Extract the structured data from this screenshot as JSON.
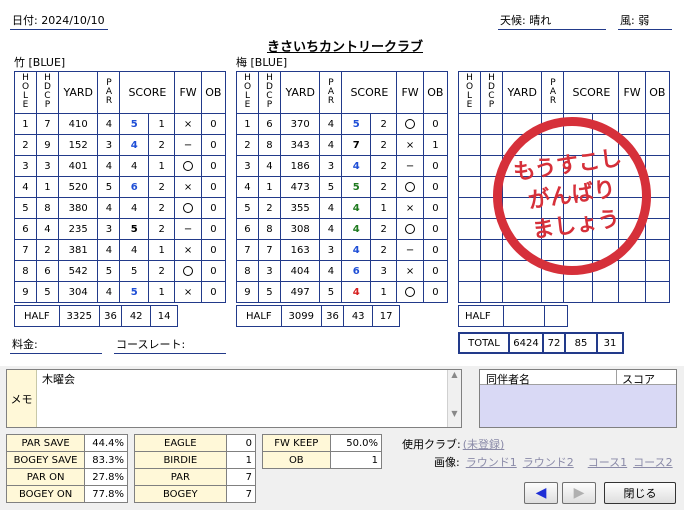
{
  "header": {
    "date": "日付: 2024/10/10",
    "weather": "天候: 晴れ",
    "wind": "風: 弱",
    "club_name": "きさいちカントリークラブ"
  },
  "courses": [
    {
      "label": "竹 [BLUE]"
    },
    {
      "label": "梅 [BLUE]"
    }
  ],
  "columns": {
    "hole": "HOLE",
    "hdcp": "HDCP",
    "yard": "YARD",
    "par": "PAR",
    "score": "SCORE",
    "fw": "FW",
    "ob": "OB"
  },
  "round1": {
    "rows": [
      {
        "hole": "1",
        "hdcp": "7",
        "yard": "410",
        "par": "4",
        "score": "5",
        "score_color": "blue",
        "putt": "1",
        "fw": "×",
        "ob": "0"
      },
      {
        "hole": "2",
        "hdcp": "9",
        "yard": "152",
        "par": "3",
        "score": "4",
        "score_color": "blue",
        "putt": "2",
        "fw": "−",
        "ob": "0"
      },
      {
        "hole": "3",
        "hdcp": "3",
        "yard": "401",
        "par": "4",
        "score": "4",
        "score_color": "plain",
        "putt": "1",
        "fw": "○",
        "ob": "0"
      },
      {
        "hole": "4",
        "hdcp": "1",
        "yard": "520",
        "par": "5",
        "score": "6",
        "score_color": "blue",
        "putt": "2",
        "fw": "×",
        "ob": "0"
      },
      {
        "hole": "5",
        "hdcp": "8",
        "yard": "380",
        "par": "4",
        "score": "4",
        "score_color": "plain",
        "putt": "2",
        "fw": "○",
        "ob": "0"
      },
      {
        "hole": "6",
        "hdcp": "4",
        "yard": "235",
        "par": "3",
        "score": "5",
        "score_color": "black",
        "putt": "2",
        "fw": "−",
        "ob": "0"
      },
      {
        "hole": "7",
        "hdcp": "2",
        "yard": "381",
        "par": "4",
        "score": "4",
        "score_color": "plain",
        "putt": "1",
        "fw": "×",
        "ob": "0"
      },
      {
        "hole": "8",
        "hdcp": "6",
        "yard": "542",
        "par": "5",
        "score": "5",
        "score_color": "plain",
        "putt": "2",
        "fw": "○",
        "ob": "0"
      },
      {
        "hole": "9",
        "hdcp": "5",
        "yard": "304",
        "par": "4",
        "score": "5",
        "score_color": "blue",
        "putt": "1",
        "fw": "×",
        "ob": "0"
      }
    ],
    "half": {
      "label": "HALF",
      "yard": "3325",
      "par": "36",
      "score": "42",
      "putt": "14"
    }
  },
  "round2": {
    "rows": [
      {
        "hole": "1",
        "hdcp": "6",
        "yard": "370",
        "par": "4",
        "score": "5",
        "score_color": "blue",
        "putt": "2",
        "fw": "○",
        "ob": "0"
      },
      {
        "hole": "2",
        "hdcp": "8",
        "yard": "343",
        "par": "4",
        "score": "7",
        "score_color": "black",
        "putt": "2",
        "fw": "×",
        "ob": "1"
      },
      {
        "hole": "3",
        "hdcp": "4",
        "yard": "186",
        "par": "3",
        "score": "4",
        "score_color": "blue",
        "putt": "2",
        "fw": "−",
        "ob": "0"
      },
      {
        "hole": "4",
        "hdcp": "1",
        "yard": "473",
        "par": "5",
        "score": "5",
        "score_color": "green",
        "putt": "2",
        "fw": "○",
        "ob": "0"
      },
      {
        "hole": "5",
        "hdcp": "2",
        "yard": "355",
        "par": "4",
        "score": "4",
        "score_color": "green",
        "putt": "1",
        "fw": "×",
        "ob": "0"
      },
      {
        "hole": "6",
        "hdcp": "8",
        "yard": "308",
        "par": "4",
        "score": "4",
        "score_color": "green",
        "putt": "2",
        "fw": "○",
        "ob": "0"
      },
      {
        "hole": "7",
        "hdcp": "7",
        "yard": "163",
        "par": "3",
        "score": "4",
        "score_color": "blue",
        "putt": "2",
        "fw": "−",
        "ob": "0"
      },
      {
        "hole": "8",
        "hdcp": "3",
        "yard": "404",
        "par": "4",
        "score": "6",
        "score_color": "blue",
        "putt": "3",
        "fw": "×",
        "ob": "0"
      },
      {
        "hole": "9",
        "hdcp": "5",
        "yard": "497",
        "par": "5",
        "score": "4",
        "score_color": "red",
        "putt": "1",
        "fw": "○",
        "ob": "0"
      }
    ],
    "half": {
      "label": "HALF",
      "yard": "3099",
      "par": "36",
      "score": "43",
      "putt": "17"
    }
  },
  "round3": {
    "half_label": "HALF"
  },
  "total": {
    "label": "TOTAL",
    "yard": "6424",
    "par": "72",
    "score": "85",
    "putt": "31"
  },
  "stamp": {
    "line1": "もうすこし",
    "line2": "がんばり",
    "line3": "ましょう",
    "color": "#d6303a"
  },
  "footer": {
    "fee_label": "料金:",
    "course_rate_label": "コースレート:"
  },
  "memo": {
    "label": "メモ",
    "text": "木曜会"
  },
  "companions": {
    "name_header": "同伴者名",
    "score_header": "スコア"
  },
  "stats_left": [
    {
      "label": "PAR SAVE",
      "value": "44.4%"
    },
    {
      "label": "BOGEY SAVE",
      "value": "83.3%"
    },
    {
      "label": "PAR ON",
      "value": "27.8%"
    },
    {
      "label": "BOGEY ON",
      "value": "77.8%"
    }
  ],
  "stats_mid": [
    {
      "label": "EAGLE",
      "value": "0"
    },
    {
      "label": "BIRDIE",
      "value": "1"
    },
    {
      "label": "PAR",
      "value": "7"
    },
    {
      "label": "BOGEY",
      "value": "7"
    }
  ],
  "stats_right": [
    {
      "label": "FW KEEP",
      "value": "50.0%"
    },
    {
      "label": "OB",
      "value": "1"
    }
  ],
  "links": {
    "clubs_label": "使用クラブ:",
    "clubs_link": "(未登録)",
    "images_label": "画像:",
    "round1": "ラウンド1",
    "round2": "ラウンド2",
    "course1": "コース1",
    "course2": "コース2"
  },
  "buttons": {
    "prev": "◀",
    "next": "▶",
    "close": "閉じる"
  },
  "colors": {
    "grid": "#223a8a",
    "blue_score": "#1f4fd6",
    "green_score": "#1f7a1f",
    "red_score": "#d62020",
    "memo_bg": "#fff8d8",
    "companion_bg": "#d9d9f5"
  }
}
